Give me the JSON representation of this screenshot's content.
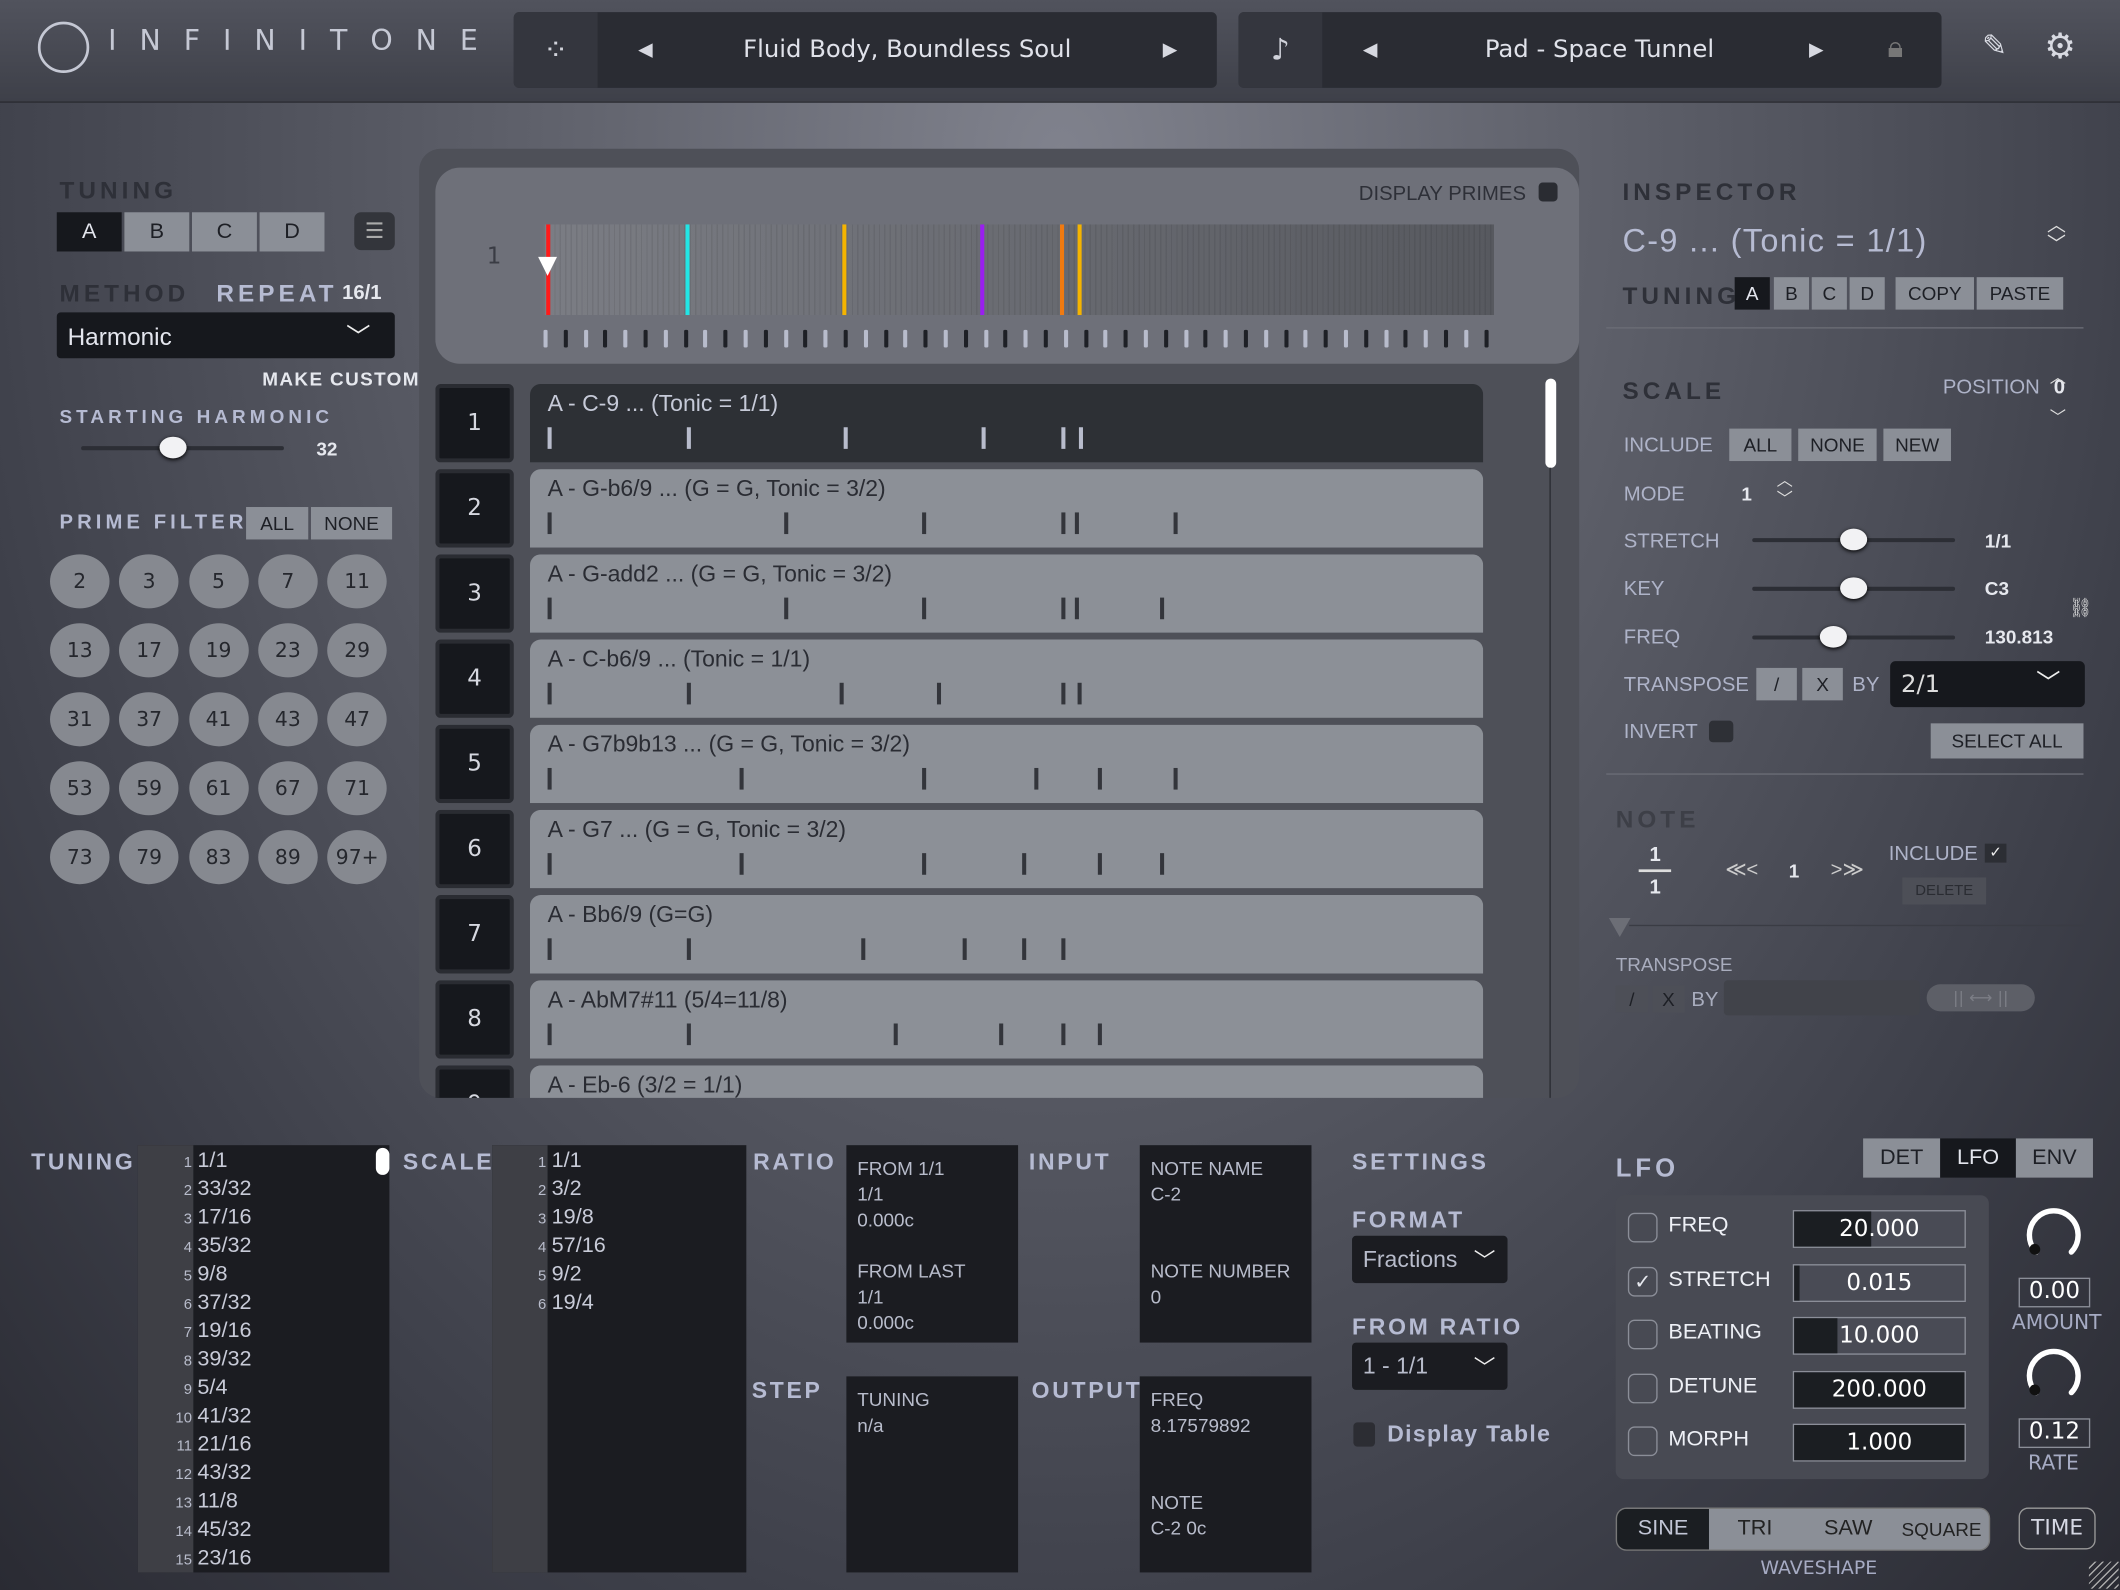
{
  "header": {
    "logo": "INFINITONE",
    "preset": "Fluid Body, Boundless Soul",
    "sound": "Pad - Space Tunnel"
  },
  "left": {
    "tuning_label": "TUNING",
    "tunings": [
      "A",
      "B",
      "C",
      "D"
    ],
    "method_label": "METHOD",
    "repeat_label": "REPEAT",
    "repeat_value": "16/1",
    "method_value": "Harmonic",
    "make_custom": "MAKE CUSTOM",
    "starting_harmonic_label": "STARTING HARMONIC",
    "starting_harmonic_value": "32",
    "starting_harmonic_level": 0.45,
    "prime_filters_label": "PRIME FILTERS",
    "all": "ALL",
    "none": "NONE",
    "primes": [
      "2",
      "3",
      "5",
      "7",
      "11",
      "13",
      "17",
      "19",
      "23",
      "29",
      "31",
      "37",
      "41",
      "43",
      "47",
      "53",
      "59",
      "61",
      "67",
      "71",
      "73",
      "79",
      "83",
      "89",
      "97+"
    ]
  },
  "center": {
    "display_primes": "DISPLAY PRIMES",
    "tuning_row_num": "1",
    "marker_colors": [
      "#ff1a1a",
      "#22e5e5",
      "#f5b400",
      "#9a1ff0",
      "#f07a10",
      "#f5b400"
    ],
    "rows": [
      {
        "num": "1",
        "label": "A - C-9 ... (Tonic = 1/1)"
      },
      {
        "num": "2",
        "label": "A - G-b6/9 ...  (G = G, Tonic = 3/2)"
      },
      {
        "num": "3",
        "label": "A - G-add2 ...  (G = G, Tonic = 3/2)"
      },
      {
        "num": "4",
        "label": "A - C-b6/9 ... (Tonic = 1/1)"
      },
      {
        "num": "5",
        "label": "A - G7b9b13 ...  (G = G, Tonic = 3/2)"
      },
      {
        "num": "6",
        "label": "A - G7 ...  (G = G, Tonic = 3/2)"
      },
      {
        "num": "7",
        "label": "A - Bb6/9 (G=G)"
      },
      {
        "num": "8",
        "label": "A - AbM7#11 (5/4=11/8)"
      },
      {
        "num": "9",
        "label": "A - Eb-6 (3/2 = 1/1)"
      }
    ]
  },
  "inspector": {
    "title": "INSPECTOR",
    "name": "C-9 ... (Tonic = 1/1)",
    "tuning_label": "TUNING",
    "tunings": [
      "A",
      "B",
      "C",
      "D"
    ],
    "copy": "COPY",
    "paste": "PASTE",
    "scale_label": "SCALE",
    "position_label": "POSITION",
    "position_value": "0",
    "include_label": "INCLUDE",
    "all": "ALL",
    "none": "NONE",
    "new": "NEW",
    "mode_label": "MODE",
    "mode_value": "1",
    "stretch_label": "STRETCH",
    "stretch_value": "1/1",
    "key_label": "KEY",
    "key_value": "C3",
    "freq_label": "FREQ",
    "freq_value": "130.813",
    "stretch_level": 0.5,
    "key_level": 0.5,
    "freq_level": 0.4,
    "transpose_label": "TRANSPOSE",
    "div": "/",
    "mul": "X",
    "by": "BY",
    "transpose_value": "2/1",
    "invert_label": "INVERT",
    "select_all": "SELECT ALL",
    "note_label": "NOTE",
    "note_num": "1",
    "note_den": "1",
    "prev": "≪<",
    "note_index": "1",
    "next": ">≫",
    "note_include": "INCLUDE",
    "note_include_check": "✓",
    "delete": "DELETE",
    "note_transpose": "TRANSPOSE",
    "note_by": "BY"
  },
  "bottom": {
    "tuning_label": "TUNING",
    "tuning_list": [
      "1/1",
      "33/32",
      "17/16",
      "35/32",
      "9/8",
      "37/32",
      "19/16",
      "39/32",
      "5/4",
      "41/32",
      "21/16",
      "43/32",
      "11/8",
      "45/32",
      "23/16"
    ],
    "scale_label": "SCALE",
    "scale_list": [
      "1/1",
      "3/2",
      "19/8",
      "57/16",
      "9/2",
      "19/4"
    ],
    "ratio_label": "RATIO",
    "ratio": [
      "FROM 1/1",
      "1/1",
      "0.000c",
      "",
      "FROM LAST",
      "1/1",
      "0.000c"
    ],
    "input_label": "INPUT",
    "input": [
      "NOTE NAME",
      "C-2",
      "",
      "",
      "NOTE NUMBER",
      "0"
    ],
    "step_label": "STEP",
    "step": [
      "TUNING",
      "n/a"
    ],
    "output_label": "OUTPUT",
    "output": [
      "FREQ",
      "8.17579892",
      "",
      "",
      "NOTE",
      "C-2 0c"
    ],
    "settings_label": "SETTINGS",
    "format_label": "FORMAT",
    "format_value": "Fractions",
    "from_ratio_label": "FROM RATIO",
    "from_ratio_value": "1 - 1/1",
    "display_table": "Display Table"
  },
  "lfo": {
    "title": "LFO",
    "tabs": [
      "DET",
      "LFO",
      "ENV"
    ],
    "active_tab": "LFO",
    "params": [
      {
        "name": "FREQ",
        "checked": false,
        "value": "20.000",
        "level": 0.45
      },
      {
        "name": "STRETCH",
        "checked": true,
        "value": "0.015",
        "level": 0.03
      },
      {
        "name": "BEATING",
        "checked": false,
        "value": "10.000",
        "level": 0.25
      },
      {
        "name": "DETUNE",
        "checked": false,
        "value": "200.000",
        "level": 1
      },
      {
        "name": "MORPH",
        "checked": false,
        "value": "1.000",
        "level": 1
      }
    ],
    "amount_value": "0.00",
    "amount_label": "AMOUNT",
    "rate_value": "0.12",
    "rate_label": "RATE",
    "waveshapes": [
      "SINE",
      "TRI",
      "SAW",
      "SQUARE"
    ],
    "active_waveshape": "SINE",
    "waveshape_label": "WAVESHAPE",
    "time": "TIME"
  }
}
